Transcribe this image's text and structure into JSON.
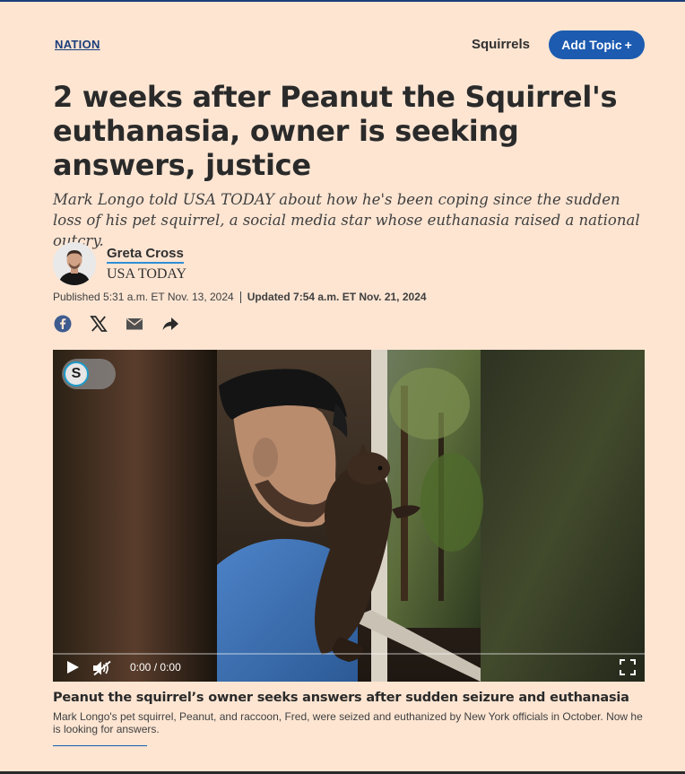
{
  "section": {
    "label": "NATION"
  },
  "topic": {
    "name": "Squirrels",
    "add_label": "Add Topic",
    "add_icon": "plus-icon"
  },
  "article": {
    "headline": "2 weeks after Peanut the Squirrel's euthanasia, owner is seeking answers, justice",
    "dek": "Mark Longo told USA TODAY about how he's been coping since the sudden loss of his pet squirrel, a social media star whose euthanasia raised a national outcry."
  },
  "byline": {
    "author": "Greta Cross",
    "publication": "USA TODAY",
    "published": "Published 5:31 a.m. ET Nov. 13, 2024",
    "updated": "Updated 7:54 a.m. ET Nov. 21, 2024"
  },
  "share": {
    "icons": [
      "facebook-icon",
      "x-icon",
      "email-icon",
      "share-arrow-icon"
    ]
  },
  "video": {
    "brand_badge": "S",
    "time_current": "0:00",
    "time_separator": "/",
    "time_total": "0:00",
    "progress": 0,
    "muted": true
  },
  "caption": {
    "title": "Peanut the squirrel’s owner seeks answers after sudden seizure and euthanasia",
    "text": "Mark Longo's pet squirrel, Peanut, and raccoon, Fred, were seized and euthanized by New York officials in October. Now he is looking for answers."
  },
  "colors": {
    "background": "#fde5d2",
    "accent_blue": "#1c5bb0",
    "section_blue": "#1a3e7a",
    "author_underline": "#2f8fd6"
  }
}
